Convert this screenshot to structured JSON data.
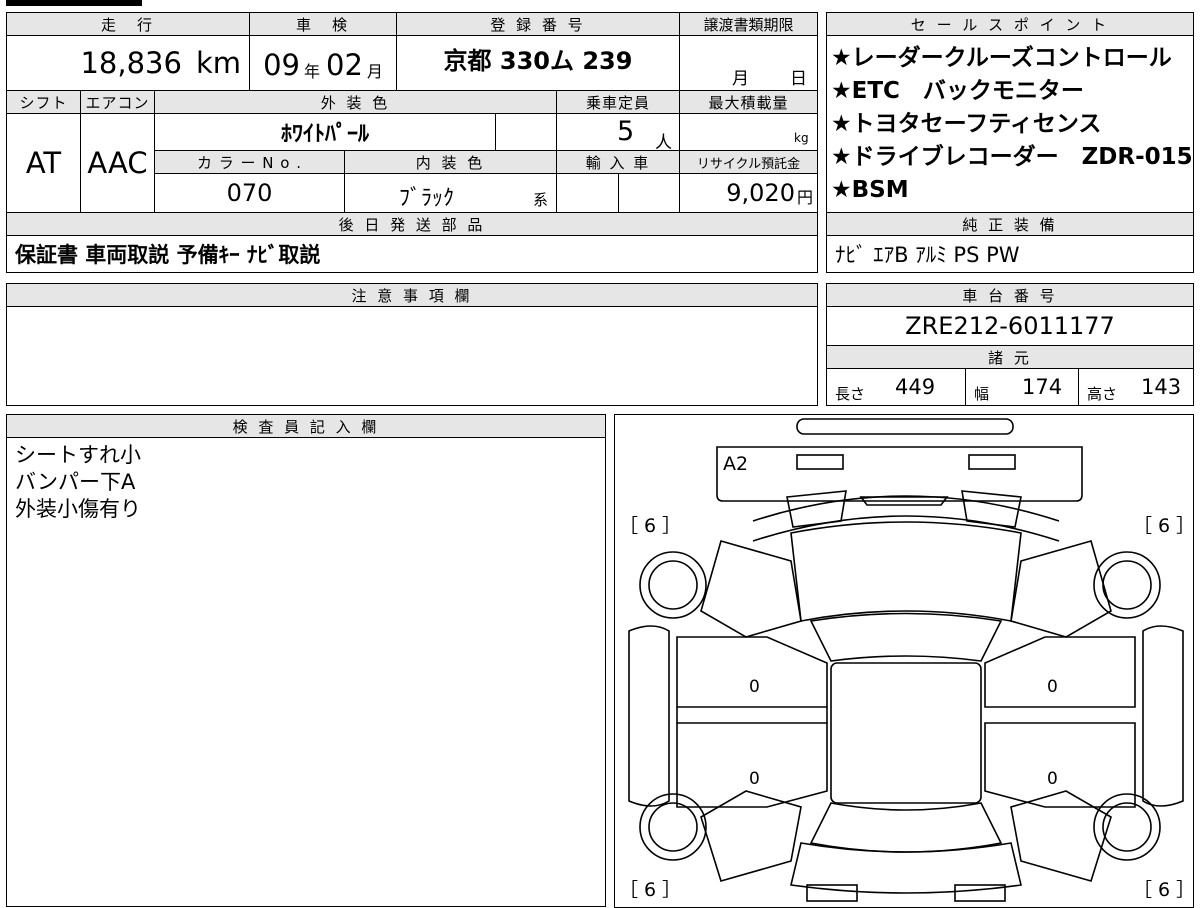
{
  "header": {
    "mileage_label": "走　行",
    "inspection_label": "車　検",
    "plate_label": "登 録 番 号",
    "transfer_deadline_label": "譲渡書類期限",
    "sales_points_label": "セ ー ル ス ポ イ ン ト"
  },
  "mileage": {
    "value": "18,836",
    "unit": "km"
  },
  "inspection": {
    "year": "09",
    "year_unit": "年",
    "month": "02",
    "month_unit": "月"
  },
  "plate": {
    "value": "京都 330ム 239"
  },
  "transfer_deadline": {
    "month_unit": "月",
    "day_unit": "日"
  },
  "row2_labels": {
    "shift": "シフト",
    "aircon": "エアコン",
    "exterior_color": "外 装 色",
    "capacity": "乗車定員",
    "max_load": "最大積載量"
  },
  "shift": "AT",
  "aircon": "AAC",
  "exterior_color": "ﾎﾜｲﾄﾊﾟｰﾙ",
  "capacity": {
    "value": "5",
    "unit": "人"
  },
  "max_load": {
    "unit": "kg"
  },
  "row3_labels": {
    "color_no": "カ ラ ー  N o .",
    "interior_color": "内 装 色",
    "import_car": "輸 入 車",
    "recycle_fee": "リサイクル預託金"
  },
  "color_no": "070",
  "interior_color": {
    "value": "ﾌﾞﾗｯｸ",
    "suffix": "系"
  },
  "recycle_fee": {
    "value": "9,020",
    "unit": "円"
  },
  "sales_points": [
    "★レーダークルーズコントロール",
    "★ETC　バックモニター",
    "★トヨタセーフティセンス",
    "★ドライブレコーダー　ZDR-015",
    "★BSM"
  ],
  "parts_to_send": {
    "label": "後 日 発 送 部 品",
    "value": "保証書 車両取説 予備ｷｰ ﾅﾋﾞ取説"
  },
  "genuine_equipment": {
    "label": "純 正 装 備",
    "value": "ﾅﾋﾞ ｴｱB ｱﾙﾐ PS PW"
  },
  "caution": {
    "label": "注 意 事 項 欄"
  },
  "chassis": {
    "label": "車 台 番 号",
    "value": "ZRE212-6011177"
  },
  "specs": {
    "label": "諸 元",
    "length_label": "長さ",
    "length": "449",
    "width_label": "幅",
    "width": "174",
    "height_label": "高さ",
    "height": "143"
  },
  "inspector": {
    "label": "検 査 員 記 入 欄",
    "notes": [
      "シートすれ小",
      "バンパー下A",
      "外装小傷有り"
    ]
  },
  "diagram": {
    "damage_code": "A2",
    "tire_depth_fl": "［ 6 ］",
    "tire_depth_fr": "［ 6 ］",
    "tire_depth_rl": "［ 6 ］",
    "tire_depth_rr": "［ 6 ］",
    "panel_left_front": "0",
    "panel_left_rear": "0",
    "panel_right_front": "0",
    "panel_right_rear": "0"
  }
}
